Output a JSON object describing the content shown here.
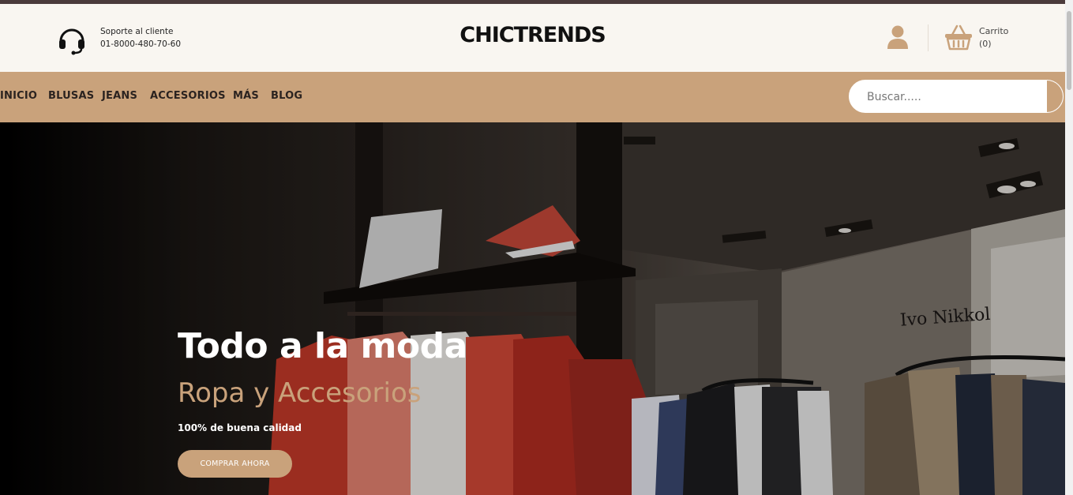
{
  "header": {
    "support_label": "Soporte al cliente",
    "support_phone": "01-8000-480-70-60",
    "logo": "CHICTRENDS",
    "cart_label": "Carrito",
    "cart_count": "(0)"
  },
  "nav": {
    "items": [
      "INICIO",
      "BLUSAS",
      "JEANS",
      "ACCESORIOS",
      "MÁS",
      "BLOG"
    ]
  },
  "search": {
    "placeholder": "Buscar....."
  },
  "hero": {
    "title": "Todo a la moda",
    "subtitle": "Ropa y Accesorios",
    "tagline": "100% de buena calidad",
    "button": "COMPRAR AHORA",
    "store_sign": "Ivo Nikkol"
  },
  "colors": {
    "accent": "#c9a27b",
    "header_bg": "#f9f6f1",
    "top_bar": "#4a3b3b"
  },
  "icons": {
    "support": "headset-icon",
    "user": "user-icon",
    "cart": "basket-icon"
  }
}
